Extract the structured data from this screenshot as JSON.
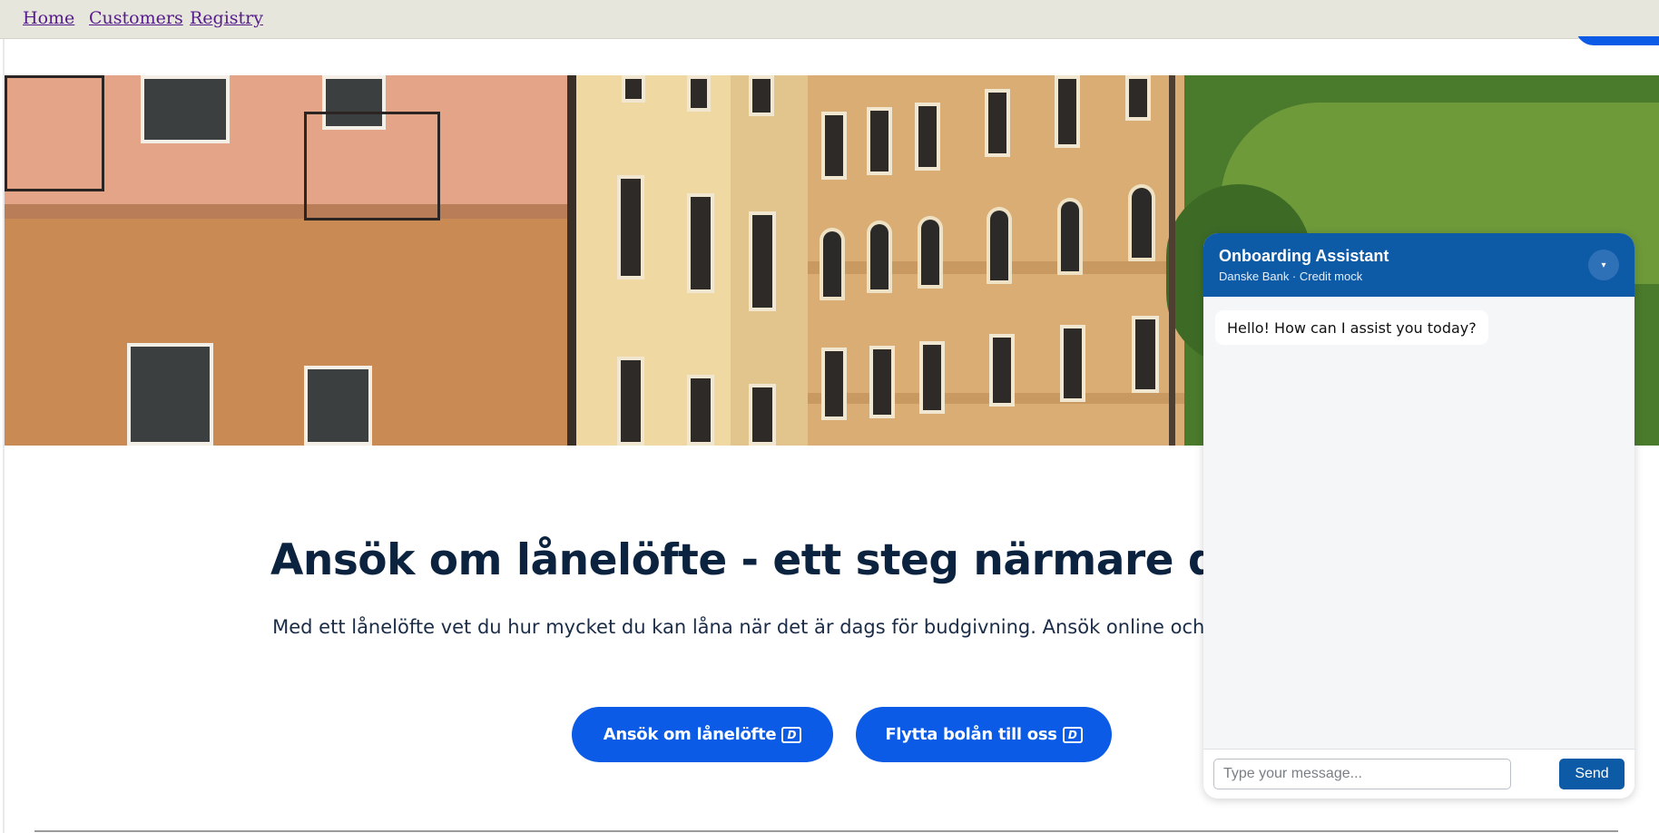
{
  "nav": {
    "items": [
      {
        "label": "Home"
      },
      {
        "label": "Customers"
      },
      {
        "label": "Registry"
      }
    ]
  },
  "hero": {
    "headline": "Ansök om lånelöfte - ett steg närmare din ny",
    "subtext": "Med ett lånelöfte vet du hur mycket du kan låna när det är dags för budgivning. Ansök online och få ett besked direkt.",
    "buttons": [
      {
        "label": "Ansök om lånelöfte",
        "icon": "danske-logo-icon"
      },
      {
        "label": "Flytta bolån till oss",
        "icon": "danske-logo-icon"
      }
    ]
  },
  "chat": {
    "title": "Onboarding Assistant",
    "subtitle": "Danske Bank · Credit mock",
    "toggle_icon": "▾",
    "messages": [
      {
        "from": "assistant",
        "text": "Hello! How can I assist you today?"
      }
    ],
    "input_placeholder": "Type your message...",
    "input_value": "",
    "send_label": "Send"
  },
  "colors": {
    "accent": "#0b5be6",
    "chat_header": "#0d5aa7",
    "headline": "#0c2340",
    "nav_bg": "#e6e6dd",
    "link": "#551a8b"
  }
}
